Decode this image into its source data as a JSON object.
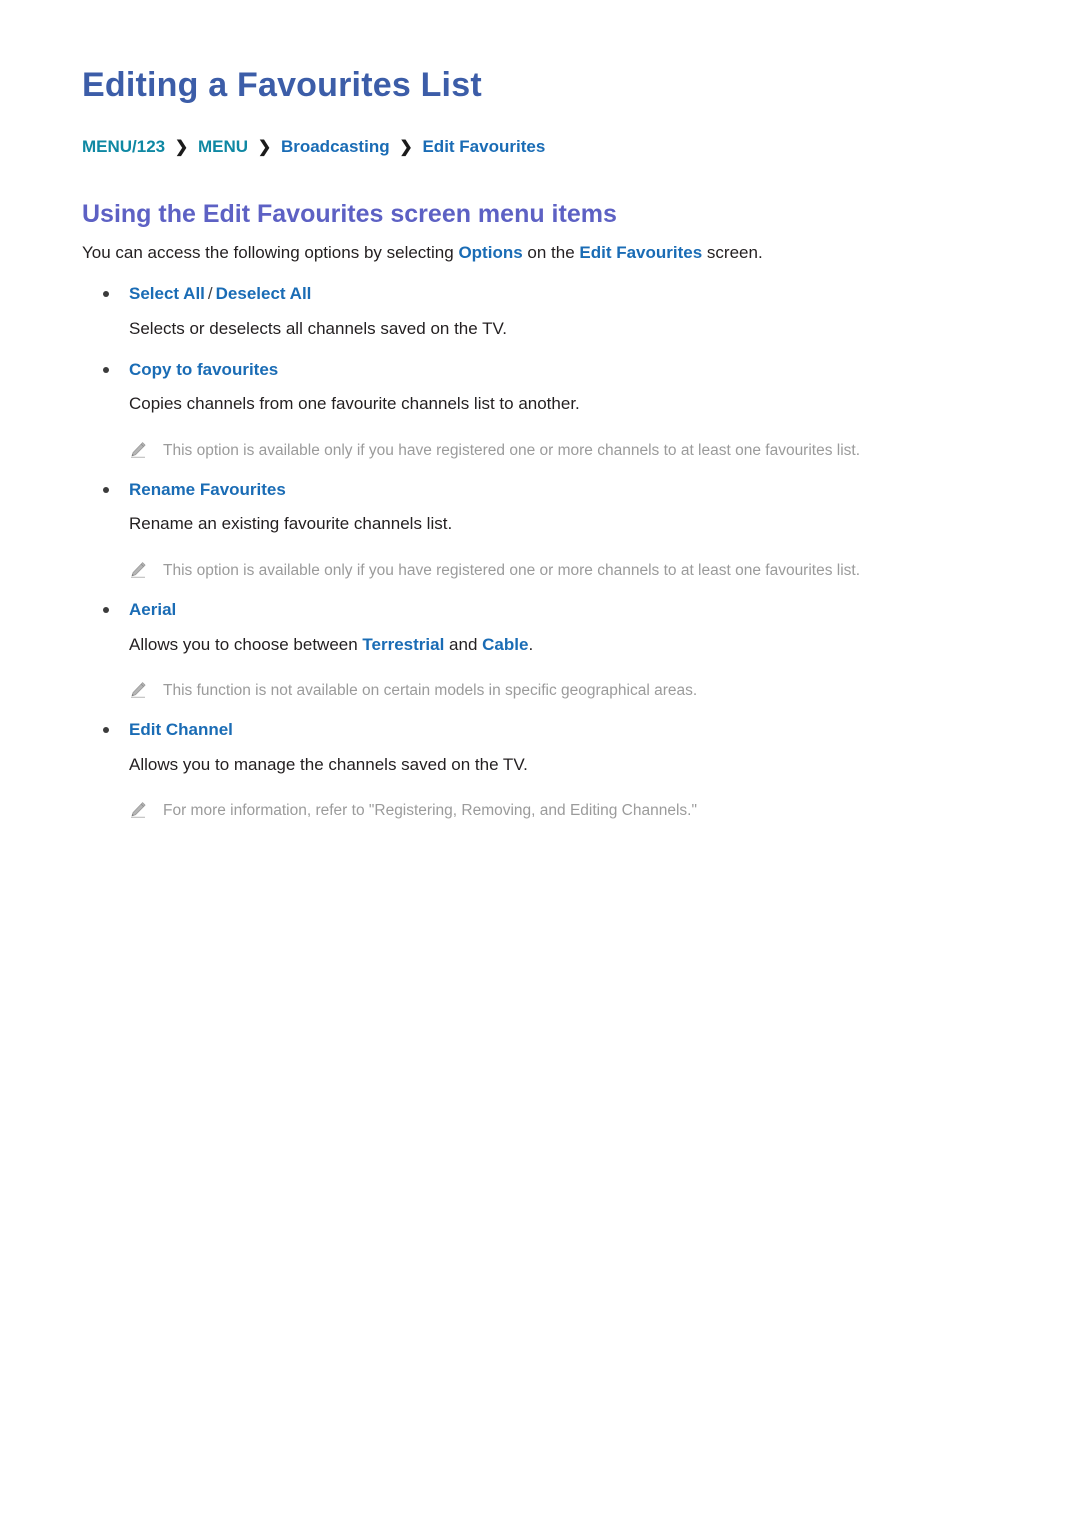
{
  "document": {
    "title": "Editing a Favourites List",
    "breadcrumb": {
      "separator": "❯",
      "items": [
        {
          "label": "MENU/123",
          "style": "teal"
        },
        {
          "label": "MENU",
          "style": "teal"
        },
        {
          "label": "Broadcasting",
          "style": "blue"
        },
        {
          "label": "Edit Favourites",
          "style": "blue"
        }
      ]
    },
    "section": {
      "heading": "Using the Edit Favourites screen menu items",
      "intro": {
        "part1": "You can access the following options by selecting ",
        "kw1": "Options",
        "part2": " on the ",
        "kw2": "Edit Favourites",
        "part3": " screen."
      }
    },
    "options": [
      {
        "title_a": "Select All",
        "slash": "/",
        "title_b": "Deselect All",
        "description": "Selects or deselects all channels saved on the TV.",
        "note": null
      },
      {
        "title_a": "Copy to favourites",
        "description": "Copies channels from one favourite channels list to another.",
        "note": "This option is available only if you have registered one or more channels to at least one favourites list."
      },
      {
        "title_a": "Rename Favourites",
        "description": "Rename an existing favourite channels list.",
        "note": "This option is available only if you have registered one or more channels to at least one favourites list."
      },
      {
        "title_a": "Aerial",
        "desc_part1": "Allows you to choose between ",
        "desc_kw1": "Terrestrial",
        "desc_part2": " and ",
        "desc_kw2": "Cable",
        "desc_part3": ".",
        "note": "This function is not available on certain models in specific geographical areas."
      },
      {
        "title_a": "Edit Channel",
        "description": "Allows you to manage the channels saved on the TV.",
        "note": "For more information, refer to \"Registering, Removing, and Editing Channels.\""
      }
    ],
    "icons": {
      "note_icon": "pencil-icon"
    },
    "colors": {
      "title": "#3c5da8",
      "heading": "#5d61c4",
      "link_blue": "#1a6cb5",
      "crumb_teal": "#0f88a3",
      "body_text": "#231f20",
      "note_text": "#9b9b9b"
    }
  }
}
